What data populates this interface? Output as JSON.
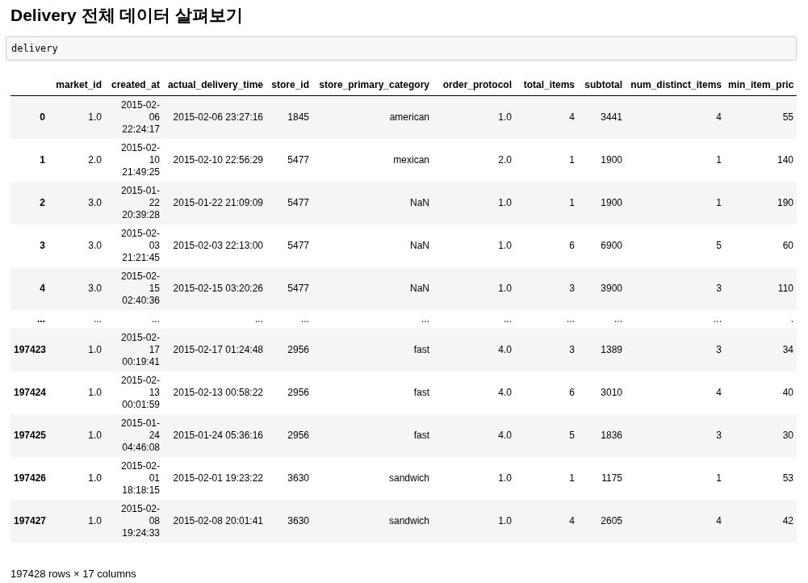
{
  "title": "Delivery 전체 데이터 살펴보기",
  "code_cell": {
    "text": "delivery"
  },
  "table": {
    "columns": [
      "market_id",
      "created_at",
      "actual_delivery_time",
      "store_id",
      "store_primary_category",
      "order_protocol",
      "total_items",
      "subtotal",
      "num_distinct_items",
      "min_item_pric"
    ],
    "rows": [
      {
        "index": "0",
        "cells": [
          "1.0",
          "2015-02-06 22:24:17",
          "2015-02-06 23:27:16",
          "1845",
          "american",
          "1.0",
          "4",
          "3441",
          "4",
          "55"
        ]
      },
      {
        "index": "1",
        "cells": [
          "2.0",
          "2015-02-10 21:49:25",
          "2015-02-10 22:56:29",
          "5477",
          "mexican",
          "2.0",
          "1",
          "1900",
          "1",
          "140"
        ]
      },
      {
        "index": "2",
        "cells": [
          "3.0",
          "2015-01-22 20:39:28",
          "2015-01-22 21:09:09",
          "5477",
          "NaN",
          "1.0",
          "1",
          "1900",
          "1",
          "190"
        ]
      },
      {
        "index": "3",
        "cells": [
          "3.0",
          "2015-02-03 21:21:45",
          "2015-02-03 22:13:00",
          "5477",
          "NaN",
          "1.0",
          "6",
          "6900",
          "5",
          "60"
        ]
      },
      {
        "index": "4",
        "cells": [
          "3.0",
          "2015-02-15 02:40:36",
          "2015-02-15 03:20:26",
          "5477",
          "NaN",
          "1.0",
          "3",
          "3900",
          "3",
          "110"
        ]
      },
      {
        "index": "...",
        "cells": [
          "...",
          "...",
          "...",
          "...",
          "...",
          "...",
          "...",
          "...",
          "...",
          "."
        ]
      },
      {
        "index": "197423",
        "cells": [
          "1.0",
          "2015-02-17 00:19:41",
          "2015-02-17 01:24:48",
          "2956",
          "fast",
          "4.0",
          "3",
          "1389",
          "3",
          "34"
        ]
      },
      {
        "index": "197424",
        "cells": [
          "1.0",
          "2015-02-13 00:01:59",
          "2015-02-13 00:58:22",
          "2956",
          "fast",
          "4.0",
          "6",
          "3010",
          "4",
          "40"
        ]
      },
      {
        "index": "197425",
        "cells": [
          "1.0",
          "2015-01-24 04:46:08",
          "2015-01-24 05:36:16",
          "2956",
          "fast",
          "4.0",
          "5",
          "1836",
          "3",
          "30"
        ]
      },
      {
        "index": "197426",
        "cells": [
          "1.0",
          "2015-02-01 18:18:15",
          "2015-02-01 19:23:22",
          "3630",
          "sandwich",
          "1.0",
          "1",
          "1175",
          "1",
          "53"
        ]
      },
      {
        "index": "197427",
        "cells": [
          "1.0",
          "2015-02-08 19:24:33",
          "2015-02-08 20:01:41",
          "3630",
          "sandwich",
          "1.0",
          "4",
          "2605",
          "4",
          "42"
        ]
      }
    ]
  },
  "footer": "197428 rows × 17 columns"
}
